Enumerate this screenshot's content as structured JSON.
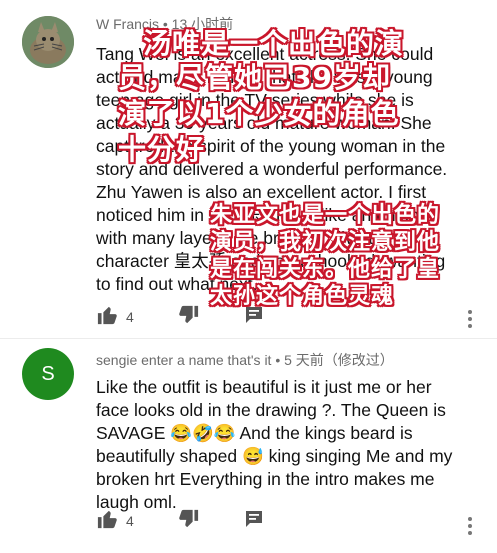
{
  "comments": [
    {
      "author": "W Francis",
      "time": " • 13 小时前",
      "text": "Tang Wei is an excellent actress. She could\nact and made believe that she was a young\nteen age girl in the TV series while she is\nactually a 39 years old mature woman. She\ncaptured the spirit of the young woman in the\nstory and delivered a wonderful performance.\nZhu Yawen is also an excellent actor. I first\nnoticed him in 闖山东 . He is like an onion\nwith many layers. He brought alive the\ncharacter 皇太孫 and got us hooked, wanting\nto find out what next.",
      "likes": "4",
      "avatar_letter": ""
    },
    {
      "author": "sengie enter a name that's it",
      "time": " • 5 天前（修改过）",
      "text": "Like the outfit is beautiful is it just me or her\nface looks old in the drawing ?. The Queen is\nSAVAGE 😂🤣😂 And the kings beard is\nbeautifully shaped 😅 king singing Me and my\nbroken hrt Everything in the intro makes me\nlaugh oml.",
      "likes": "4",
      "avatar_letter": "S"
    }
  ],
  "overlay_caption": {
    "lines": [
      "汤唯是一个出色的演",
      "员，尽管她已39岁却",
      "演了以1个少女的角色",
      "十分好"
    ],
    "small_lines": [
      "朱亚文也是一个出色的",
      "演员，我初次注意到他",
      "是在闯关东。他给了皇",
      "太孙这个角色灵魂"
    ]
  },
  "colors": {
    "overlay_outline": "#c9162b",
    "avatar2": "#1f8a1f"
  },
  "icons": [
    "like-icon",
    "dislike-icon",
    "reply-icon",
    "more-icon"
  ]
}
